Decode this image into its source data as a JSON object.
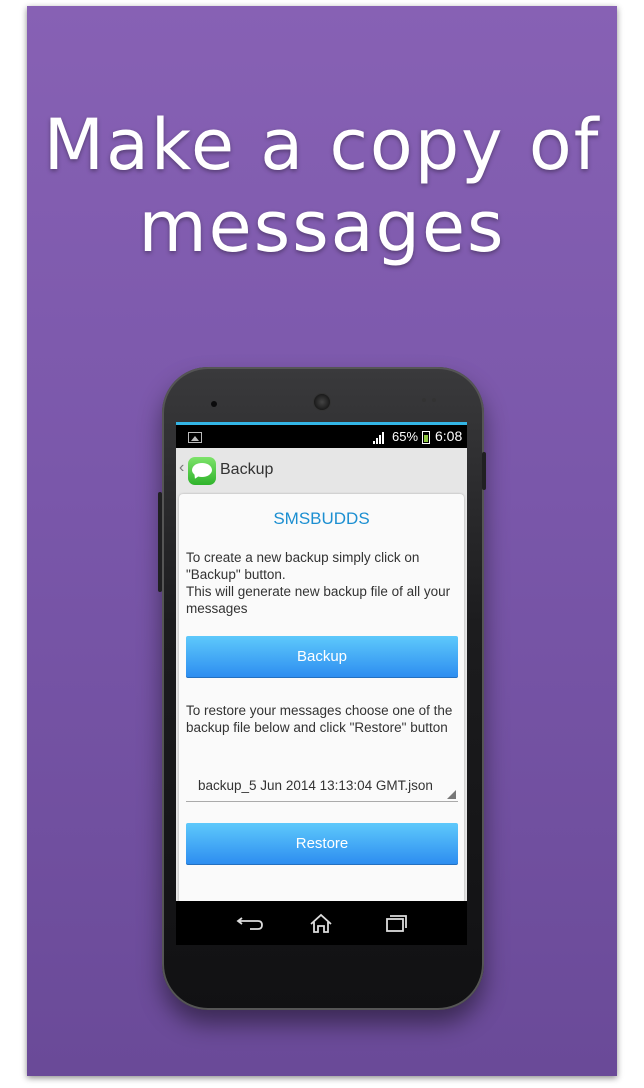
{
  "headline": {
    "line1": "Make a copy of",
    "line2": "messages"
  },
  "statusbar": {
    "battery_percent": "65%",
    "battery_level": 0.65,
    "time": "6:08"
  },
  "app": {
    "title": "Backup",
    "icon": "messages-app-icon"
  },
  "card": {
    "brand": "SMSBUDDS",
    "backup_instructions_1": "To create a new backup simply click on \"Backup\" button.",
    "backup_instructions_2": "This will generate new backup file of all your messages",
    "backup_button": "Backup",
    "restore_instructions": "To restore your messages choose one of the backup file below and click \"Restore\" button",
    "backup_file_selected": "backup_5 Jun 2014 13:13:04 GMT.json",
    "restore_button": "Restore"
  },
  "navbar": {
    "icons": [
      "back-icon",
      "home-icon",
      "recents-icon"
    ]
  },
  "colors": {
    "poster": "#7b58ab",
    "accent": "#33b5e5",
    "button": "#2c8cf0",
    "brand": "#1c8fd1"
  }
}
